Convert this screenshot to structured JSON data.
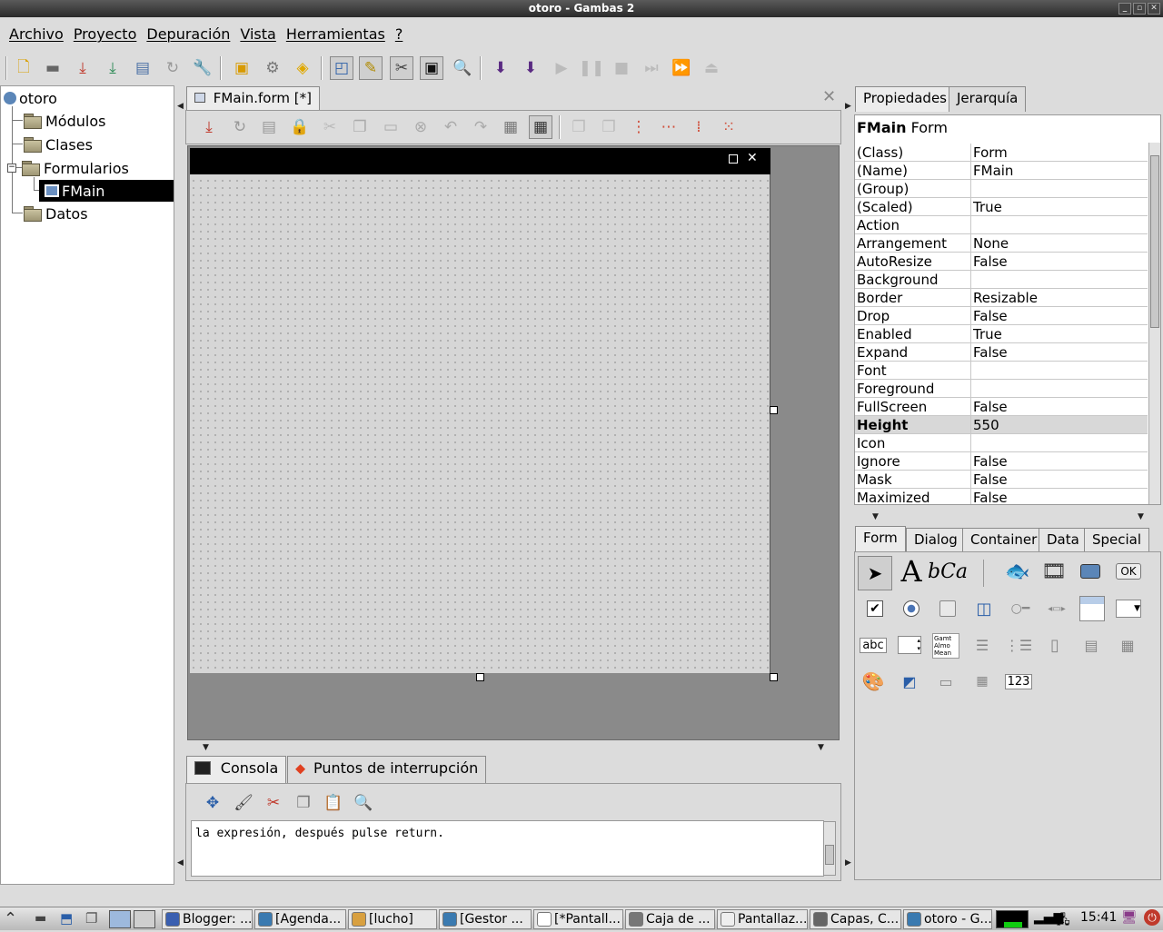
{
  "window": {
    "title": "otoro - Gambas 2"
  },
  "menubar": [
    "Archivo",
    "Proyecto",
    "Depuración",
    "Vista",
    "Herramientas",
    "?"
  ],
  "toolbar_icons": [
    "new-file-icon",
    "open-folder-icon",
    "save-icon",
    "save-as-icon",
    "project-properties-icon",
    "refresh-icon",
    "tools-wrench-icon",
    "package-icon",
    "components-gear-icon",
    "make-executable-icon",
    "form-view-icon",
    "edit-code-icon",
    "scissors-tool-icon",
    "console-icon",
    "search-icon",
    "step-into-icon",
    "step-over-icon",
    "run-icon",
    "pause-icon",
    "stop-icon",
    "forward-icon",
    "fast-forward-icon",
    "return-icon"
  ],
  "project_tree": {
    "root": "otoro",
    "items": [
      {
        "label": "Módulos",
        "type": "folder"
      },
      {
        "label": "Clases",
        "type": "folder"
      },
      {
        "label": "Formularios",
        "type": "folder"
      },
      {
        "label": "FMain",
        "type": "form",
        "selected": true
      },
      {
        "label": "Datos",
        "type": "folder"
      }
    ]
  },
  "editor": {
    "tab_label": "FMain.form [*]",
    "form_toolbar_icons": [
      "save-icon",
      "reload-icon",
      "properties-icon",
      "lock-icon",
      "cut-icon",
      "copy-icon",
      "paste-icon",
      "delete-icon",
      "undo-icon",
      "redo-icon",
      "menu-editor-icon",
      "grid-icon",
      "bring-front-icon",
      "send-back-icon",
      "align-vertical-icon",
      "align-horizontal-icon",
      "distribute-icon",
      "distribute-grid-icon"
    ]
  },
  "console": {
    "tabs": [
      "Consola",
      "Puntos de interrupción"
    ],
    "output": "la expresión, después pulse return."
  },
  "properties": {
    "tabs": [
      "Propiedades",
      "Jerarquía"
    ],
    "header_name": "FMain",
    "header_type": "Form",
    "rows": [
      {
        "name": "(Class)",
        "value": "Form"
      },
      {
        "name": "(Name)",
        "value": "FMain"
      },
      {
        "name": "(Group)",
        "value": ""
      },
      {
        "name": "(Scaled)",
        "value": "True"
      },
      {
        "name": "Action",
        "value": ""
      },
      {
        "name": "Arrangement",
        "value": "None"
      },
      {
        "name": "AutoResize",
        "value": "False"
      },
      {
        "name": "Background",
        "value": ""
      },
      {
        "name": "Border",
        "value": "Resizable"
      },
      {
        "name": "Drop",
        "value": "False"
      },
      {
        "name": "Enabled",
        "value": "True"
      },
      {
        "name": "Expand",
        "value": "False"
      },
      {
        "name": "Font",
        "value": ""
      },
      {
        "name": "Foreground",
        "value": ""
      },
      {
        "name": "FullScreen",
        "value": "False"
      },
      {
        "name": "Height",
        "value": "550",
        "selected": true
      },
      {
        "name": "Icon",
        "value": ""
      },
      {
        "name": "Ignore",
        "value": "False"
      },
      {
        "name": "Mask",
        "value": "False"
      },
      {
        "name": "Maximized",
        "value": "False"
      }
    ]
  },
  "toolbox": {
    "tabs": [
      "Form",
      "Dialog",
      "Container",
      "Data",
      "Special"
    ],
    "active_tab": "Form",
    "text_labels": {
      "label_glyph": "A",
      "textlabel_glyph": "bCa",
      "button": "OK",
      "textbox": "abc",
      "listbox_sample": "Gamt Almo Mean",
      "valuebox": "123"
    }
  },
  "taskbar": {
    "tasks": [
      "Blogger: ...",
      "[Agenda...",
      "[lucho]",
      "[Gestor ...",
      "[*Pantall...",
      "Caja de ...",
      "Pantallaz...",
      "Capas, C...",
      "otoro - G..."
    ],
    "clock": "15:41"
  }
}
